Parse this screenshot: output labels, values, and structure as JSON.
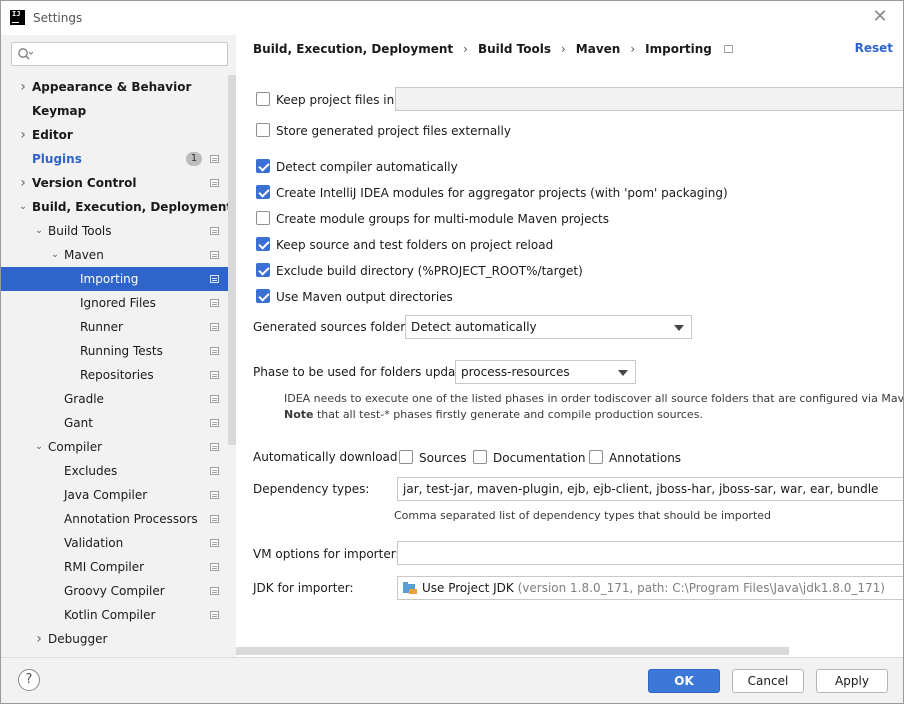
{
  "window": {
    "title": "Settings",
    "close_glyph": "✕"
  },
  "search": {
    "placeholder": "",
    "value": ""
  },
  "sidebar": {
    "items": [
      {
        "label": "Appearance & Behavior",
        "style": "bold",
        "arrow": "right"
      },
      {
        "label": "Keymap",
        "style": "bold",
        "arrow": ""
      },
      {
        "label": "Editor",
        "style": "bold",
        "arrow": "right"
      },
      {
        "label": "Plugins",
        "style": "blue",
        "arrow": "",
        "badge": "1"
      },
      {
        "label": "Version Control",
        "style": "bold",
        "arrow": "right",
        "proj": true
      },
      {
        "label": "Build, Execution, Deployment",
        "style": "bold",
        "arrow": "down"
      },
      {
        "label": "Build Tools",
        "arrow": "down",
        "proj": true
      },
      {
        "label": "Maven",
        "arrow": "down",
        "proj": true
      },
      {
        "label": "Importing",
        "selected": true,
        "proj": true
      },
      {
        "label": "Ignored Files",
        "proj": true
      },
      {
        "label": "Runner",
        "proj": true
      },
      {
        "label": "Running Tests",
        "proj": true
      },
      {
        "label": "Repositories",
        "proj": true
      },
      {
        "label": "Gradle",
        "proj": true
      },
      {
        "label": "Gant",
        "proj": true
      },
      {
        "label": "Compiler",
        "arrow": "down",
        "proj": true
      },
      {
        "label": "Excludes",
        "proj": true
      },
      {
        "label": "Java Compiler",
        "proj": true
      },
      {
        "label": "Annotation Processors",
        "proj": true
      },
      {
        "label": "Validation",
        "proj": true
      },
      {
        "label": "RMI Compiler",
        "proj": true
      },
      {
        "label": "Groovy Compiler",
        "proj": true
      },
      {
        "label": "Kotlin Compiler",
        "proj": true
      },
      {
        "label": "Debugger",
        "arrow": "right"
      }
    ]
  },
  "breadcrumb": {
    "items": [
      "Build, Execution, Deployment",
      "Build Tools",
      "Maven",
      "Importing"
    ],
    "separator": "›"
  },
  "reset_label": "Reset",
  "options": {
    "keep_project_files": {
      "label": "Keep project files in:",
      "checked": false,
      "value": ""
    },
    "store_externally": {
      "label": "Store generated project files externally",
      "checked": false
    },
    "detect_compiler": {
      "label": "Detect compiler automatically",
      "checked": true
    },
    "create_modules": {
      "label": "Create IntelliJ IDEA modules for aggregator projects (with 'pom' packaging)",
      "checked": true
    },
    "module_groups": {
      "label": "Create module groups for multi-module Maven projects",
      "checked": false
    },
    "keep_source_folders": {
      "label": "Keep source and test folders on project reload",
      "checked": true
    },
    "exclude_build_dir": {
      "label": "Exclude build directory (%PROJECT_ROOT%/target)",
      "checked": true
    },
    "use_maven_output": {
      "label": "Use Maven output directories",
      "checked": true
    }
  },
  "generated_sources": {
    "label": "Generated sources folders:",
    "value": "Detect automatically"
  },
  "phase": {
    "label": "Phase to be used for folders update:",
    "value": "process-resources",
    "hint_line1": "IDEA needs to execute one of the listed phases in order todiscover all source folders that are configured via Maven plugi",
    "hint_note_bold": "Note",
    "hint_line2": " that all test-* phases firstly generate and compile production sources."
  },
  "auto_download": {
    "label": "Automatically download:",
    "sources": {
      "label": "Sources",
      "checked": false
    },
    "documentation": {
      "label": "Documentation",
      "checked": false
    },
    "annotations": {
      "label": "Annotations",
      "checked": false
    }
  },
  "dependency_types": {
    "label": "Dependency types:",
    "value": "jar, test-jar, maven-plugin, ejb, ejb-client, jboss-har, jboss-sar, war, ear, bundle",
    "hint": "Comma separated list of dependency types that should be imported"
  },
  "vm_options": {
    "label": "VM options for importer:",
    "value": ""
  },
  "jdk": {
    "label": "JDK for importer:",
    "value": "Use Project JDK",
    "detail": "(version 1.8.0_171, path: C:\\Program Files\\Java\\jdk1.8.0_171)"
  },
  "footer": {
    "help": "?",
    "ok": "OK",
    "cancel": "Cancel",
    "apply": "Apply"
  },
  "colors": {
    "accent": "#2f65ca",
    "checkbox": "#3b6fd1",
    "sidebar_bg": "#f2f2f2"
  }
}
